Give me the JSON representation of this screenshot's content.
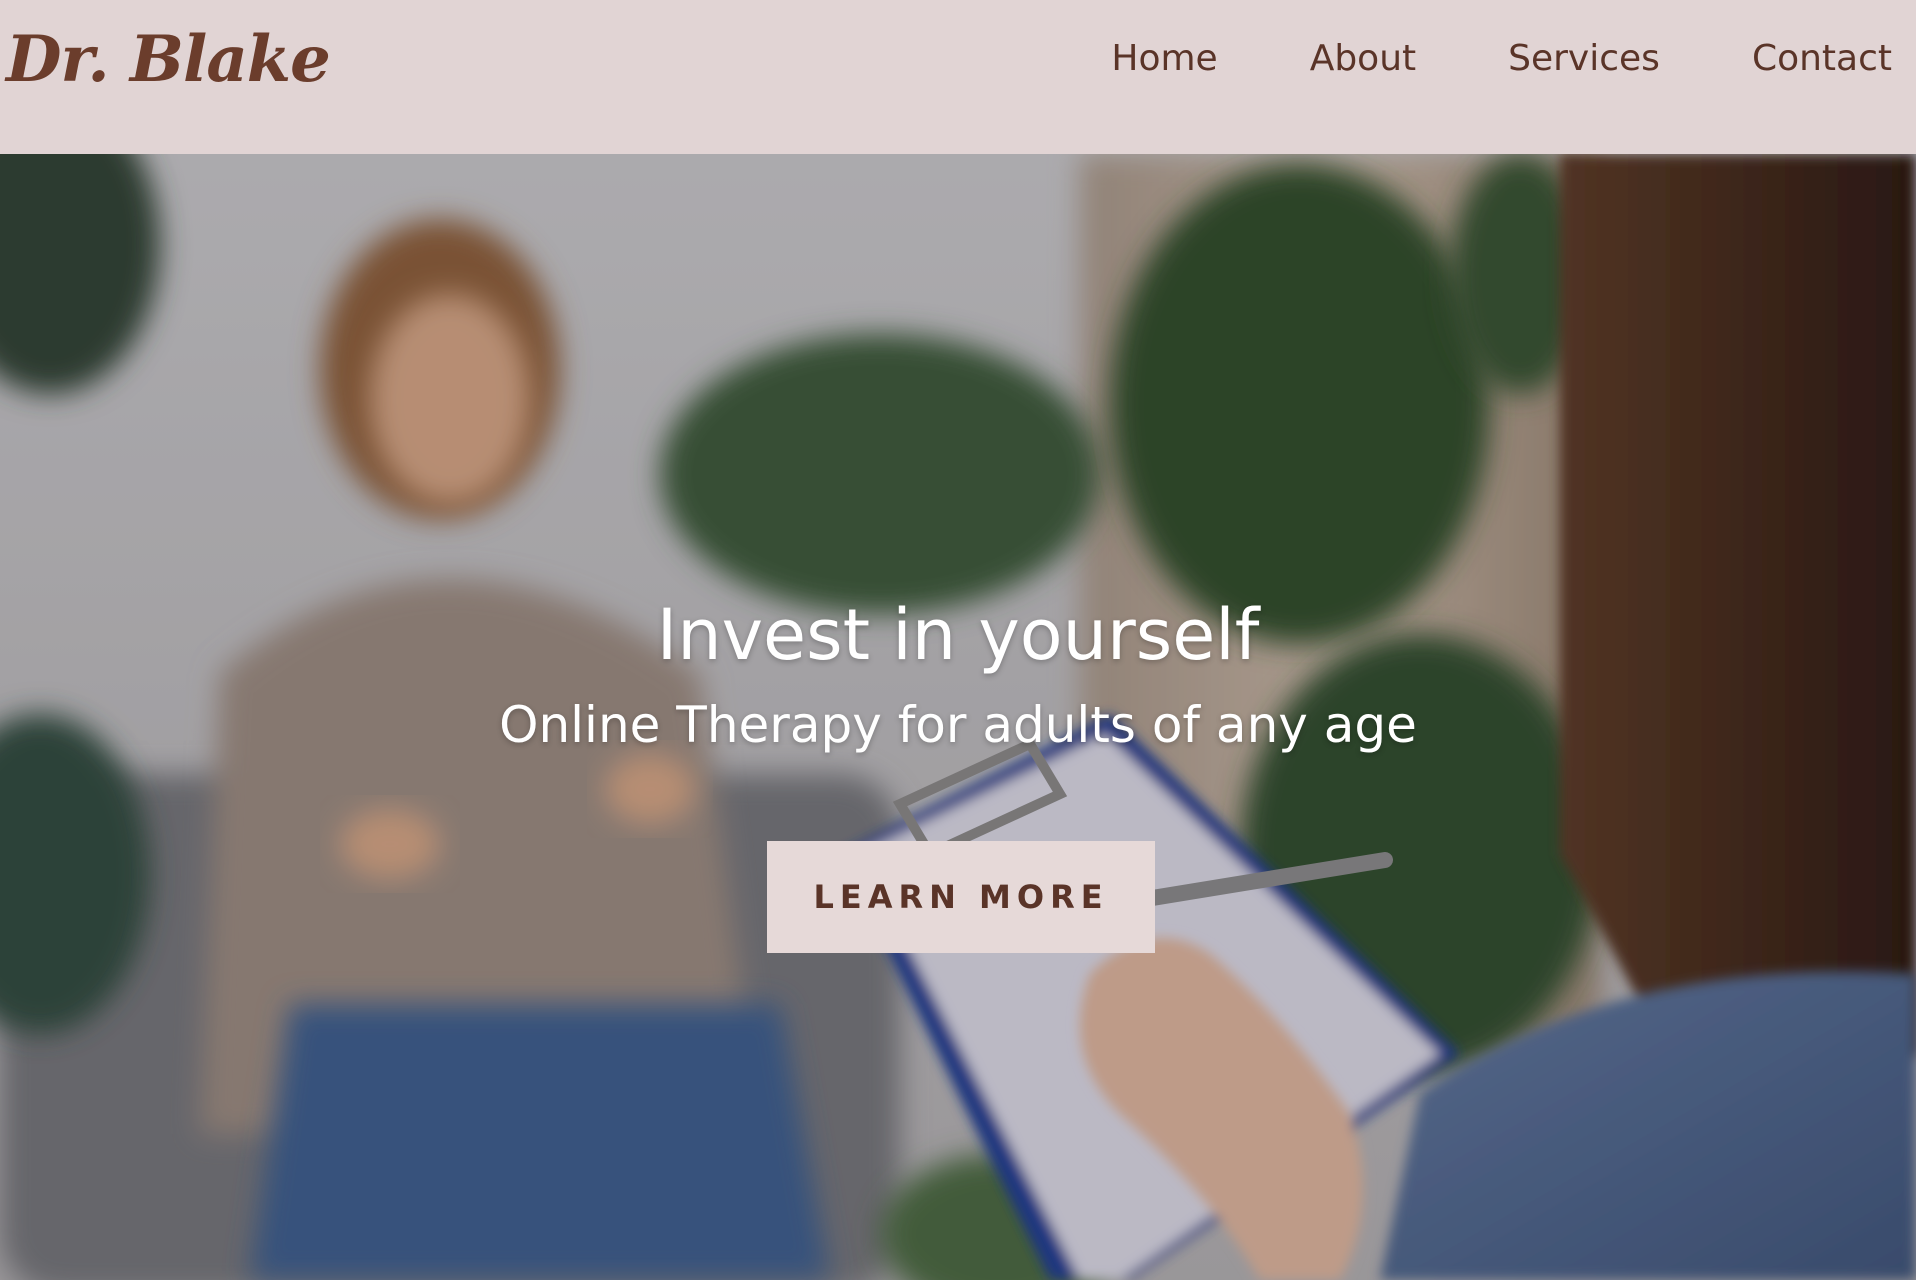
{
  "header": {
    "logo": "Dr. Blake",
    "nav": [
      "Home",
      "About",
      "Services",
      "Contact"
    ]
  },
  "hero": {
    "title": "Invest in yourself",
    "subtitle": "Online Therapy for adults of any age",
    "cta_label": "LEARN MORE",
    "image_description": "therapy-session-photo"
  },
  "colors": {
    "header_bg": "#e1d4d4",
    "brand_brown": "#6b3d2c",
    "nav_text": "#5a3428",
    "button_bg": "#e6d9d8",
    "hero_text": "#ffffff"
  }
}
